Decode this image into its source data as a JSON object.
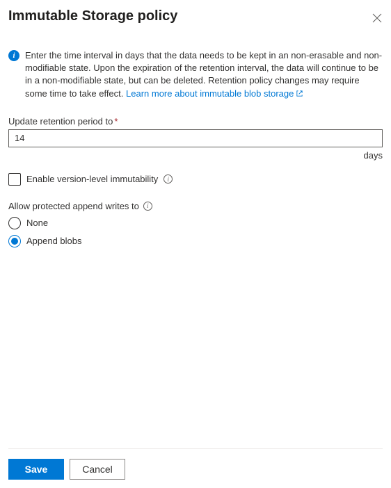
{
  "header": {
    "title": "Immutable Storage policy"
  },
  "info": {
    "text": "Enter the time interval in days that the data needs to be kept in an non-erasable and non-modifiable state. Upon the expiration of the retention interval, the data will continue to be in a non-modifiable state, but can be deleted. Retention policy changes may require some time to take effect. ",
    "link_label": "Learn more about immutable blob storage"
  },
  "retention": {
    "label": "Update retention period to",
    "value": "14",
    "unit": "days"
  },
  "version_level": {
    "label": "Enable version-level immutability"
  },
  "append_section": {
    "label": "Allow protected append writes to",
    "options": {
      "none": "None",
      "append_blobs": "Append blobs"
    },
    "selected": "append_blobs"
  },
  "footer": {
    "save": "Save",
    "cancel": "Cancel"
  }
}
